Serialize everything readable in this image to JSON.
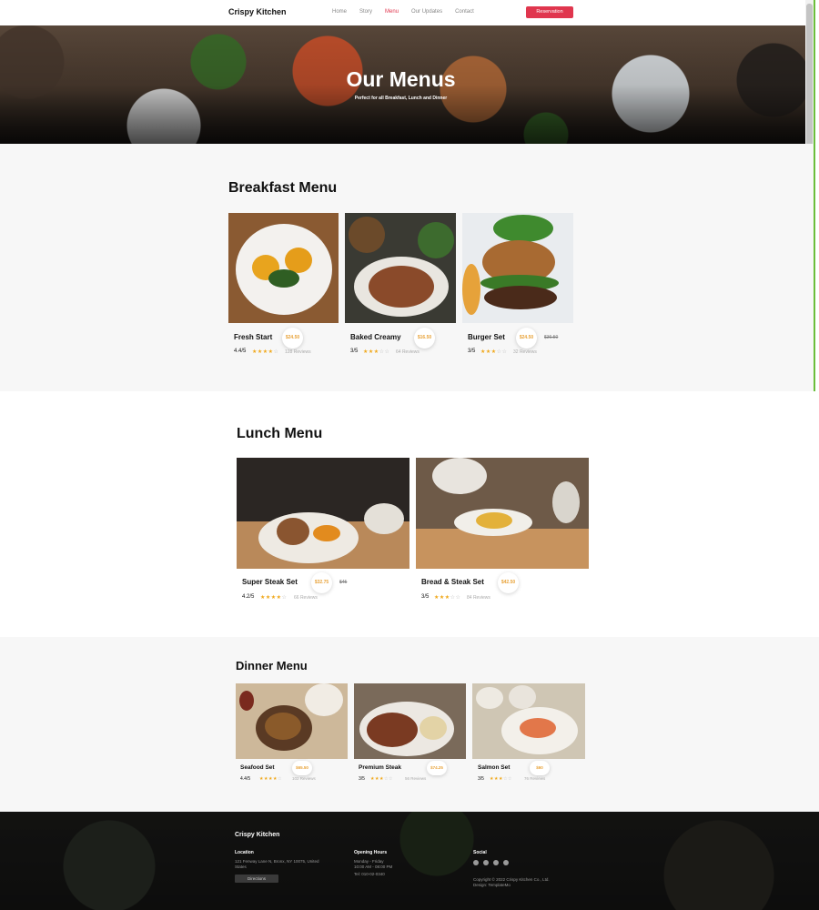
{
  "nav": {
    "brand": "Crispy Kitchen",
    "links": [
      "Home",
      "Story",
      "Menu",
      "Our Updates",
      "Contact"
    ],
    "active_link": "Menu",
    "reservation_label": "Reservation",
    "accent_color": "#e0364e"
  },
  "hero": {
    "title": "Our Menus",
    "subtitle": "Perfect for all Breakfast, Lunch and Dinner"
  },
  "breakfast": {
    "title": "Breakfast Menu",
    "items": [
      {
        "name": "Fresh Start",
        "price": "$24.50",
        "old_price": "",
        "rating": "4.4/5",
        "stars": 4,
        "reviews": "128 Reviews"
      },
      {
        "name": "Baked Creamy",
        "price": "$16.50",
        "old_price": "",
        "rating": "3/5",
        "stars": 3,
        "reviews": "64 Reviews"
      },
      {
        "name": "Burger Set",
        "price": "$24.50",
        "old_price": "$36.50",
        "rating": "3/5",
        "stars": 3,
        "reviews": "32 Reviews"
      }
    ]
  },
  "lunch": {
    "title": "Lunch Menu",
    "items": [
      {
        "name": "Super Steak Set",
        "price": "$32.75",
        "old_price": "$45",
        "rating": "4.2/5",
        "stars": 4,
        "reviews": "66 Reviews"
      },
      {
        "name": "Bread & Steak Set",
        "price": "$42.50",
        "old_price": "",
        "rating": "3/5",
        "stars": 3,
        "reviews": "84 Reviews"
      }
    ]
  },
  "dinner": {
    "title": "Dinner Menu",
    "items": [
      {
        "name": "Seafood Set",
        "price": "$65.50",
        "old_price": "",
        "rating": "4.4/5",
        "stars": 4,
        "reviews": "102 Reviews"
      },
      {
        "name": "Premium Steak",
        "price": "$74.25",
        "old_price": "",
        "rating": "3/5",
        "stars": 3,
        "reviews": "56 Reviews"
      },
      {
        "name": "Salmon Set",
        "price": "$60",
        "old_price": "",
        "rating": "3/5",
        "stars": 3,
        "reviews": "76 Reviews"
      }
    ]
  },
  "footer": {
    "brand": "Crispy Kitchen",
    "location_heading": "Location",
    "address": [
      "121 Fenway Lane N, Bronx, NY 10075, United",
      "States"
    ],
    "directions_label": "Directions",
    "hours_heading": "Opening Hours",
    "hours": [
      "Monday - Friday",
      "10:00 AM - 08:00 PM",
      "Tel: 010-02-0340"
    ],
    "social_heading": "Social",
    "copyright": [
      "Copyright © 2022 Crispy Kitchen Co., Ltd.",
      "Design: TemplateMo"
    ],
    "social_icons": [
      "facebook-icon",
      "instagram-icon",
      "twitter-icon",
      "youtube-icon"
    ]
  },
  "colors": {
    "price": "#e8a33a",
    "star": "#f0a81a",
    "green_accent": "#6bbe3b"
  }
}
